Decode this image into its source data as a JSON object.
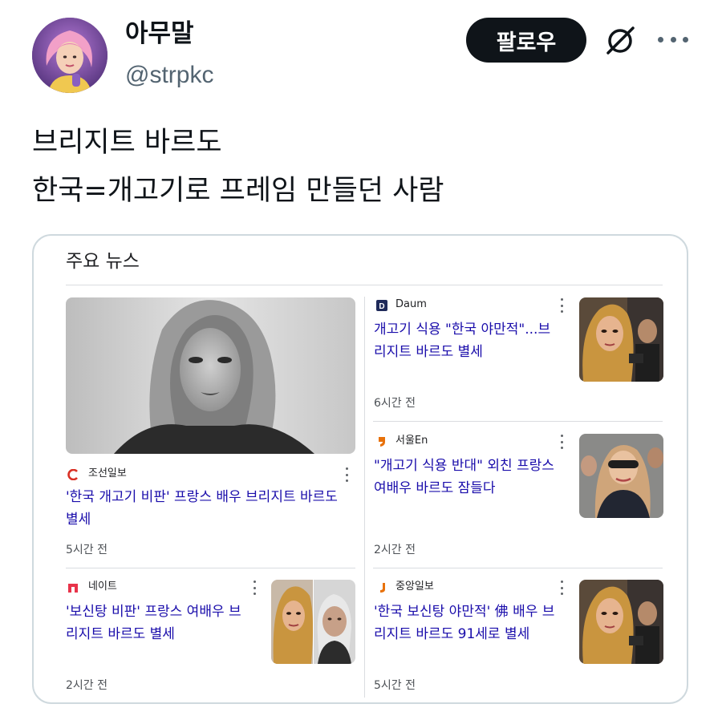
{
  "user": {
    "display_name": "아무말",
    "handle": "@strpkc"
  },
  "actions": {
    "follow_label": "팔로우"
  },
  "tweet": {
    "lines": [
      "브리지트 바르도",
      "한국=개고기로 프레임 만들던 사람"
    ]
  },
  "news_card": {
    "title": "주요 뉴스",
    "items": [
      {
        "source": "조선일보",
        "headline_lines": [
          "'한국 개고기 비판' 프랑스 배우 브리지트 바르도",
          "별세"
        ],
        "time": "5시간 전",
        "logo_color": "#d93025"
      },
      {
        "source": "Daum",
        "headline_lines": [
          "개고기 식용 \"한국 야만적\"...브",
          "리지트 바르도 별세"
        ],
        "time": "6시간 전",
        "logo_color": "#1f2a5a"
      },
      {
        "source": "서울En",
        "headline_lines": [
          "\"개고기 식용 반대\" 외친 프랑스",
          "여배우 바르도 잠들다"
        ],
        "time": "2시간 전",
        "logo_color": "#e8710a"
      },
      {
        "source": "네이트",
        "headline_lines": [
          "'보신탕 비판' 프랑스 여배우 브",
          "리지트 바르도 별세"
        ],
        "time": "2시간 전",
        "logo_color": "#e8334a"
      },
      {
        "source": "중앙일보",
        "headline_lines": [
          "'한국 보신탕 야만적' 佛 배우 브",
          "리지트 바르도 91세로 별세"
        ],
        "time": "5시간 전",
        "logo_color": "#e8710a"
      }
    ]
  },
  "colors": {
    "link": "#1a0dab",
    "text": "#0f1419",
    "muted": "#536471",
    "follow_bg": "#0f1419",
    "border": "#cfd9de"
  },
  "icons": {
    "grok": "slashed-circle-icon",
    "more": "ellipsis-icon",
    "kebab": "vertical-ellipsis-icon"
  }
}
